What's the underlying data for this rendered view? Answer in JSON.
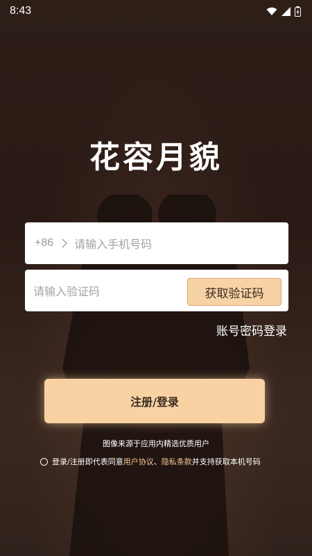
{
  "status_bar": {
    "time": "8:43",
    "icons": [
      "wifi-icon",
      "signal-icon",
      "battery-icon"
    ]
  },
  "app": {
    "logo_text": "花容月貌"
  },
  "phone_input": {
    "prefix": "+86",
    "placeholder": "请输入手机号码"
  },
  "code_input": {
    "placeholder": "请输入验证码",
    "get_code_label": "获取验证码"
  },
  "account_login_label": "账号密码登录",
  "register_button_label": "注册/登录",
  "source_note": "图像来源于应用内精选优质用户",
  "agreement": {
    "prefix": "登录/注册即代表同意",
    "user_agreement": "用户协议",
    "separator": "、",
    "privacy": "隐私条款",
    "suffix": "并支持获取本机号码"
  },
  "colors": {
    "accent": "#f8d2a3",
    "background": "#2a1c16",
    "link": "#f5c896"
  }
}
